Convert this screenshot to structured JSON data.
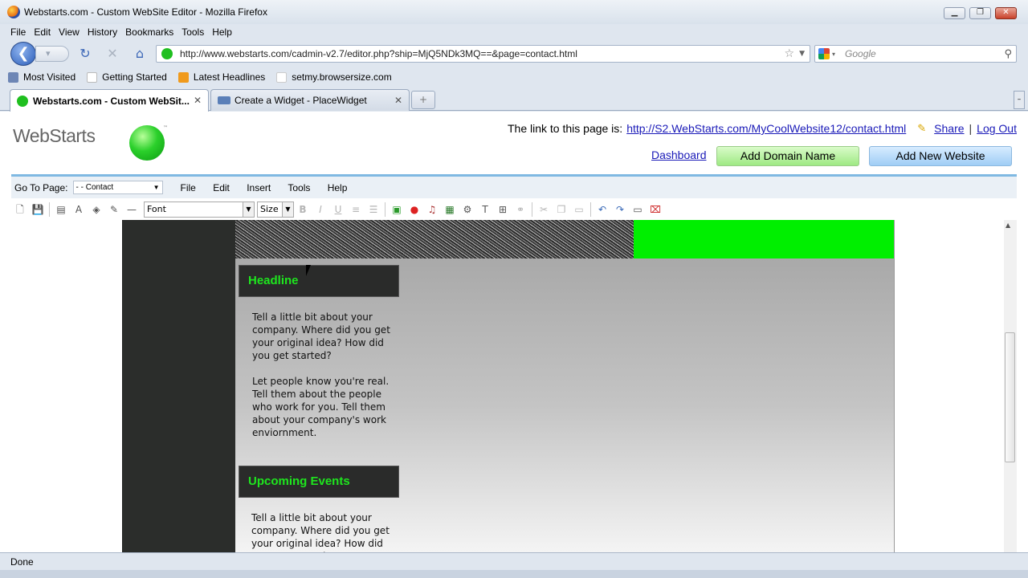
{
  "window": {
    "title": "Webstarts.com - Custom WebSite Editor - Mozilla Firefox"
  },
  "menu": [
    "File",
    "Edit",
    "View",
    "History",
    "Bookmarks",
    "Tools",
    "Help"
  ],
  "nav": {
    "url": "http://www.webstarts.com/cadmin-v2.7/editor.php?ship=MjQ5NDk3MQ==&page=contact.html",
    "search_placeholder": "Google"
  },
  "bookmarks": [
    "Most Visited",
    "Getting Started",
    "Latest Headlines",
    "setmy.browsersize.com"
  ],
  "tabs": [
    {
      "label": "Webstarts.com - Custom WebSit...",
      "close": "✕"
    },
    {
      "label": "Create a Widget - PlaceWidget",
      "close": "✕"
    }
  ],
  "header": {
    "logo": "WebStarts",
    "tm": "™",
    "link_prefix": "The link to this page is:",
    "page_link": "http://S2.WebStarts.com/MyCoolWebsite12/contact.html",
    "share": "Share",
    "logout": "Log Out",
    "separator": "|",
    "dashboard": "Dashboard",
    "add_domain": "Add Domain Name",
    "add_website": "Add New Website"
  },
  "editor": {
    "goto_label": "Go To Page:",
    "goto_value": "- - Contact",
    "menu": [
      "File",
      "Edit",
      "Insert",
      "Tools",
      "Help"
    ],
    "font_value": "Font",
    "size_value": "Size"
  },
  "page": {
    "sections": [
      {
        "headline": "Headline",
        "paragraphs": [
          "Tell a little bit about your company. Where did you get your original idea? How did you get started?",
          "Let people know you're real. Tell them about the people who work for you. Tell them about your company's work enviornment."
        ]
      },
      {
        "headline": "Upcoming Events",
        "paragraphs": [
          "Tell a little bit about your company. Where did you get your original idea? How did you get started?"
        ]
      }
    ]
  },
  "status": {
    "text": "Done"
  },
  "colors": {
    "accent_green": "#00ef00",
    "headline_green": "#1ee61e",
    "link_blue": "#1a1ab8"
  }
}
